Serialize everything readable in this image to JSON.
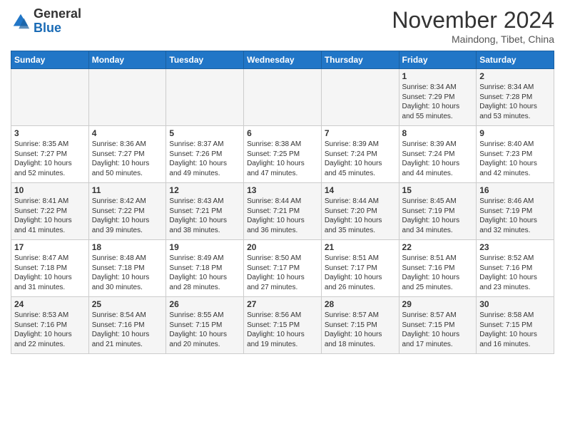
{
  "header": {
    "logo_general": "General",
    "logo_blue": "Blue",
    "month_title": "November 2024",
    "location": "Maindong, Tibet, China"
  },
  "weekdays": [
    "Sunday",
    "Monday",
    "Tuesday",
    "Wednesday",
    "Thursday",
    "Friday",
    "Saturday"
  ],
  "weeks": [
    [
      {
        "day": "",
        "info": ""
      },
      {
        "day": "",
        "info": ""
      },
      {
        "day": "",
        "info": ""
      },
      {
        "day": "",
        "info": ""
      },
      {
        "day": "",
        "info": ""
      },
      {
        "day": "1",
        "info": "Sunrise: 8:34 AM\nSunset: 7:29 PM\nDaylight: 10 hours and 55 minutes."
      },
      {
        "day": "2",
        "info": "Sunrise: 8:34 AM\nSunset: 7:28 PM\nDaylight: 10 hours and 53 minutes."
      }
    ],
    [
      {
        "day": "3",
        "info": "Sunrise: 8:35 AM\nSunset: 7:27 PM\nDaylight: 10 hours and 52 minutes."
      },
      {
        "day": "4",
        "info": "Sunrise: 8:36 AM\nSunset: 7:27 PM\nDaylight: 10 hours and 50 minutes."
      },
      {
        "day": "5",
        "info": "Sunrise: 8:37 AM\nSunset: 7:26 PM\nDaylight: 10 hours and 49 minutes."
      },
      {
        "day": "6",
        "info": "Sunrise: 8:38 AM\nSunset: 7:25 PM\nDaylight: 10 hours and 47 minutes."
      },
      {
        "day": "7",
        "info": "Sunrise: 8:39 AM\nSunset: 7:24 PM\nDaylight: 10 hours and 45 minutes."
      },
      {
        "day": "8",
        "info": "Sunrise: 8:39 AM\nSunset: 7:24 PM\nDaylight: 10 hours and 44 minutes."
      },
      {
        "day": "9",
        "info": "Sunrise: 8:40 AM\nSunset: 7:23 PM\nDaylight: 10 hours and 42 minutes."
      }
    ],
    [
      {
        "day": "10",
        "info": "Sunrise: 8:41 AM\nSunset: 7:22 PM\nDaylight: 10 hours and 41 minutes."
      },
      {
        "day": "11",
        "info": "Sunrise: 8:42 AM\nSunset: 7:22 PM\nDaylight: 10 hours and 39 minutes."
      },
      {
        "day": "12",
        "info": "Sunrise: 8:43 AM\nSunset: 7:21 PM\nDaylight: 10 hours and 38 minutes."
      },
      {
        "day": "13",
        "info": "Sunrise: 8:44 AM\nSunset: 7:21 PM\nDaylight: 10 hours and 36 minutes."
      },
      {
        "day": "14",
        "info": "Sunrise: 8:44 AM\nSunset: 7:20 PM\nDaylight: 10 hours and 35 minutes."
      },
      {
        "day": "15",
        "info": "Sunrise: 8:45 AM\nSunset: 7:19 PM\nDaylight: 10 hours and 34 minutes."
      },
      {
        "day": "16",
        "info": "Sunrise: 8:46 AM\nSunset: 7:19 PM\nDaylight: 10 hours and 32 minutes."
      }
    ],
    [
      {
        "day": "17",
        "info": "Sunrise: 8:47 AM\nSunset: 7:18 PM\nDaylight: 10 hours and 31 minutes."
      },
      {
        "day": "18",
        "info": "Sunrise: 8:48 AM\nSunset: 7:18 PM\nDaylight: 10 hours and 30 minutes."
      },
      {
        "day": "19",
        "info": "Sunrise: 8:49 AM\nSunset: 7:18 PM\nDaylight: 10 hours and 28 minutes."
      },
      {
        "day": "20",
        "info": "Sunrise: 8:50 AM\nSunset: 7:17 PM\nDaylight: 10 hours and 27 minutes."
      },
      {
        "day": "21",
        "info": "Sunrise: 8:51 AM\nSunset: 7:17 PM\nDaylight: 10 hours and 26 minutes."
      },
      {
        "day": "22",
        "info": "Sunrise: 8:51 AM\nSunset: 7:16 PM\nDaylight: 10 hours and 25 minutes."
      },
      {
        "day": "23",
        "info": "Sunrise: 8:52 AM\nSunset: 7:16 PM\nDaylight: 10 hours and 23 minutes."
      }
    ],
    [
      {
        "day": "24",
        "info": "Sunrise: 8:53 AM\nSunset: 7:16 PM\nDaylight: 10 hours and 22 minutes."
      },
      {
        "day": "25",
        "info": "Sunrise: 8:54 AM\nSunset: 7:16 PM\nDaylight: 10 hours and 21 minutes."
      },
      {
        "day": "26",
        "info": "Sunrise: 8:55 AM\nSunset: 7:15 PM\nDaylight: 10 hours and 20 minutes."
      },
      {
        "day": "27",
        "info": "Sunrise: 8:56 AM\nSunset: 7:15 PM\nDaylight: 10 hours and 19 minutes."
      },
      {
        "day": "28",
        "info": "Sunrise: 8:57 AM\nSunset: 7:15 PM\nDaylight: 10 hours and 18 minutes."
      },
      {
        "day": "29",
        "info": "Sunrise: 8:57 AM\nSunset: 7:15 PM\nDaylight: 10 hours and 17 minutes."
      },
      {
        "day": "30",
        "info": "Sunrise: 8:58 AM\nSunset: 7:15 PM\nDaylight: 10 hours and 16 minutes."
      }
    ]
  ]
}
